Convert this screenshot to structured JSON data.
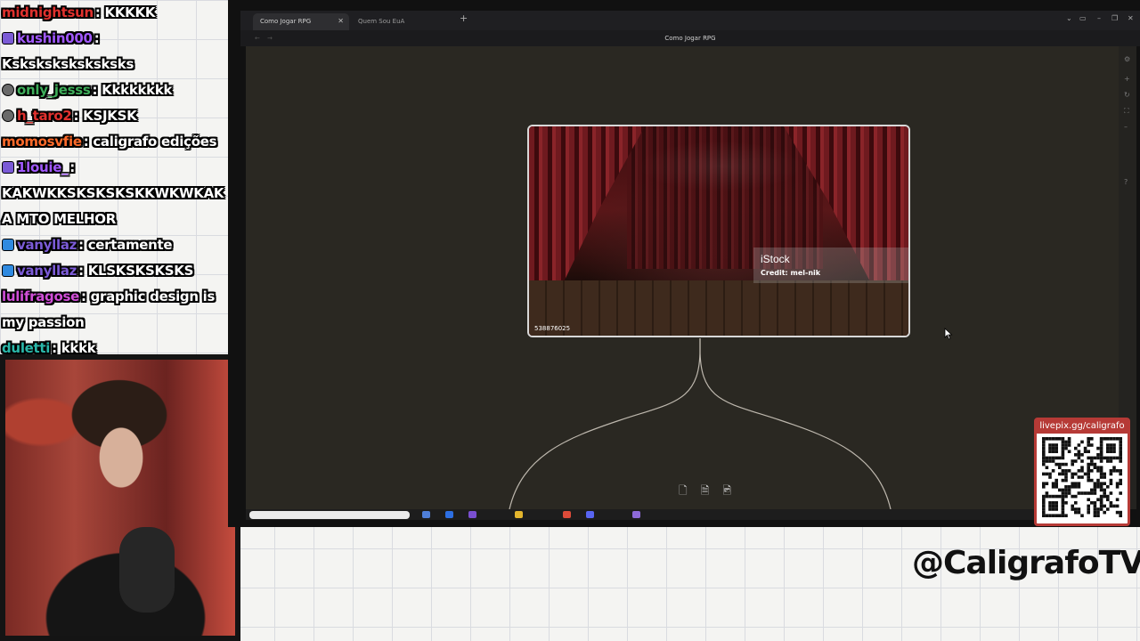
{
  "chat": [
    {
      "user": "midnightsun",
      "color": "#e0312e",
      "badge": "",
      "message": "KKKKK"
    },
    {
      "user": "kushin000",
      "color": "#a259ff",
      "badge": "sub",
      "message": ""
    },
    {
      "user": "",
      "color": "#ffffff",
      "badge": "",
      "message": "Ksksksksksksksks"
    },
    {
      "user": "only_jesss",
      "color": "#3fae5a",
      "badge": "gift",
      "message": "Kkkkkkkk"
    },
    {
      "user": "h_taro2",
      "color": "#e0312e",
      "badge": "gift",
      "message": "KSJKSK"
    },
    {
      "user": "momosvfie",
      "color": "#ff6b2b",
      "badge": "",
      "message": "caligrafo edições"
    },
    {
      "user": "1louie_",
      "color": "#a259ff",
      "badge": "sub",
      "message": ""
    },
    {
      "user": "",
      "color": "#ffffff",
      "badge": "",
      "message": "KAKWKKSKSKSKSKKWKWKAK"
    },
    {
      "user": "",
      "color": "#ffffff",
      "badge": "",
      "message": "A MTO MELHOR"
    },
    {
      "user": "vanyllaz",
      "color": "#7b5bd6",
      "badge": "prime",
      "message": "certamente"
    },
    {
      "user": "vanyllaz",
      "color": "#7b5bd6",
      "badge": "prime",
      "message": "KLSKSKSKSKS"
    },
    {
      "user": "lulifragose",
      "color": "#d14fd8",
      "badge": "",
      "message": "graphic design is"
    },
    {
      "user": "",
      "color": "#ffffff",
      "badge": "",
      "message": "my passion"
    },
    {
      "user": "duletti",
      "color": "#2ab7a9",
      "badge": "",
      "message": "kkkk"
    }
  ],
  "browser": {
    "tabs": [
      {
        "label": "Como Jogar RPG",
        "active": true
      },
      {
        "label": "Quem Sou EuA",
        "active": false
      }
    ],
    "new_tab_icon": "+",
    "page_title": "Como Jogar RPG"
  },
  "image_card": {
    "watermark_brand": "iStock",
    "watermark_credit": "Credit: mel-nik",
    "image_id": "538876025"
  },
  "node_tools": [
    {
      "icon": "file-icon",
      "glyph": "🗋"
    },
    {
      "icon": "note-icon",
      "glyph": "🗎"
    },
    {
      "icon": "image-icon",
      "glyph": "🖻"
    }
  ],
  "overlay": {
    "qr_label": "livepix.gg/caligrafo",
    "handle": "@CaligrafoTV"
  },
  "colors": {
    "canvas_bg": "#2a2822",
    "qr_border": "#b63a36"
  }
}
